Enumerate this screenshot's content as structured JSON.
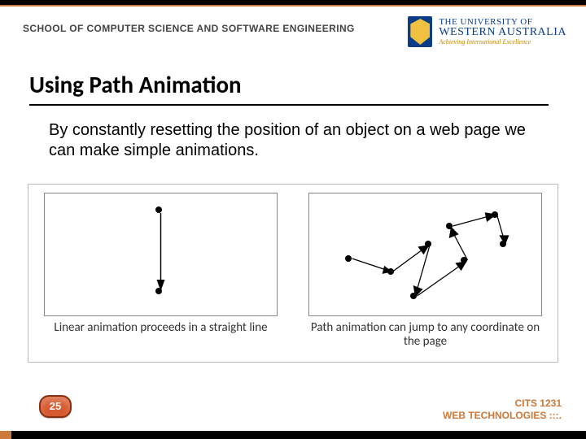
{
  "department": "SCHOOL OF COMPUTER SCIENCE AND SOFTWARE ENGINEERING",
  "university": {
    "line1": "THE UNIVERSITY OF",
    "line2": "WESTERN AUSTRALIA",
    "tagline": "Achieving International Excellence"
  },
  "slide": {
    "title": "Using Path Animation",
    "body": "By constantly resetting the position of an object on a web page we can make simple animations."
  },
  "figure": {
    "left_caption": "Linear animation proceeds in a straight line",
    "right_caption": "Path animation can jump to any coordinate on the page"
  },
  "page_number": "25",
  "footer": {
    "course": "CITS 1231",
    "subtitle": "WEB TECHNOLOGIES :::."
  }
}
